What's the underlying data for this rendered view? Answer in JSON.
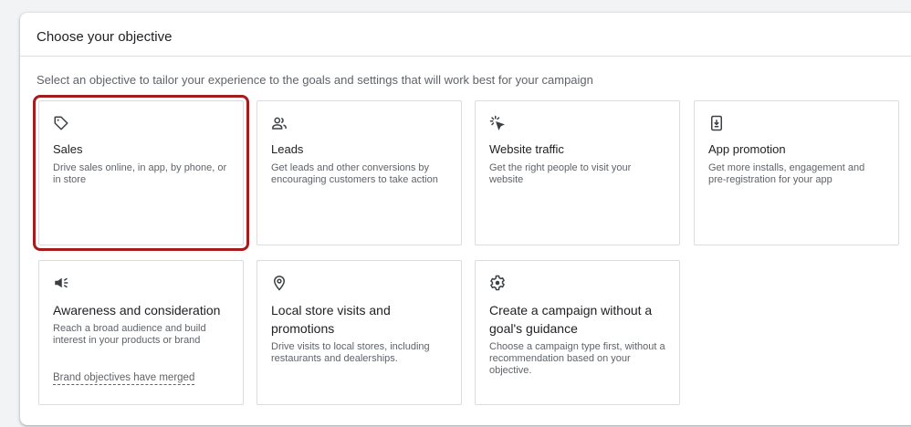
{
  "header": {
    "title": "Choose your objective"
  },
  "subtitle": "Select an objective to tailor your experience to the goals and settings that will work best for your campaign",
  "selected_color": "#a61c1c",
  "cards": [
    {
      "icon": "tag-icon",
      "title": "Sales",
      "desc": "Drive sales online, in app, by phone, or in store",
      "selected": true
    },
    {
      "icon": "people-icon",
      "title": "Leads",
      "desc": "Get leads and other conversions by encouraging customers to take action"
    },
    {
      "icon": "cursor-click-icon",
      "title": "Website traffic",
      "desc": "Get the right people to visit your website"
    },
    {
      "icon": "phone-download-icon",
      "title": "App promotion",
      "desc": "Get more installs, engagement and pre-registration for your app"
    },
    {
      "icon": "megaphone-icon",
      "title": "Awareness and consideration",
      "desc": "Reach a broad audience and build interest in your products or brand",
      "link": "Brand objectives have merged"
    },
    {
      "icon": "location-pin-icon",
      "title": "Local store visits and promotions",
      "desc": "Drive visits to local stores, including restaurants and dealerships."
    },
    {
      "icon": "gear-icon",
      "title": "Create a campaign without a goal's guidance",
      "desc": "Choose a campaign type first, without a recommendation based on your objective."
    }
  ]
}
